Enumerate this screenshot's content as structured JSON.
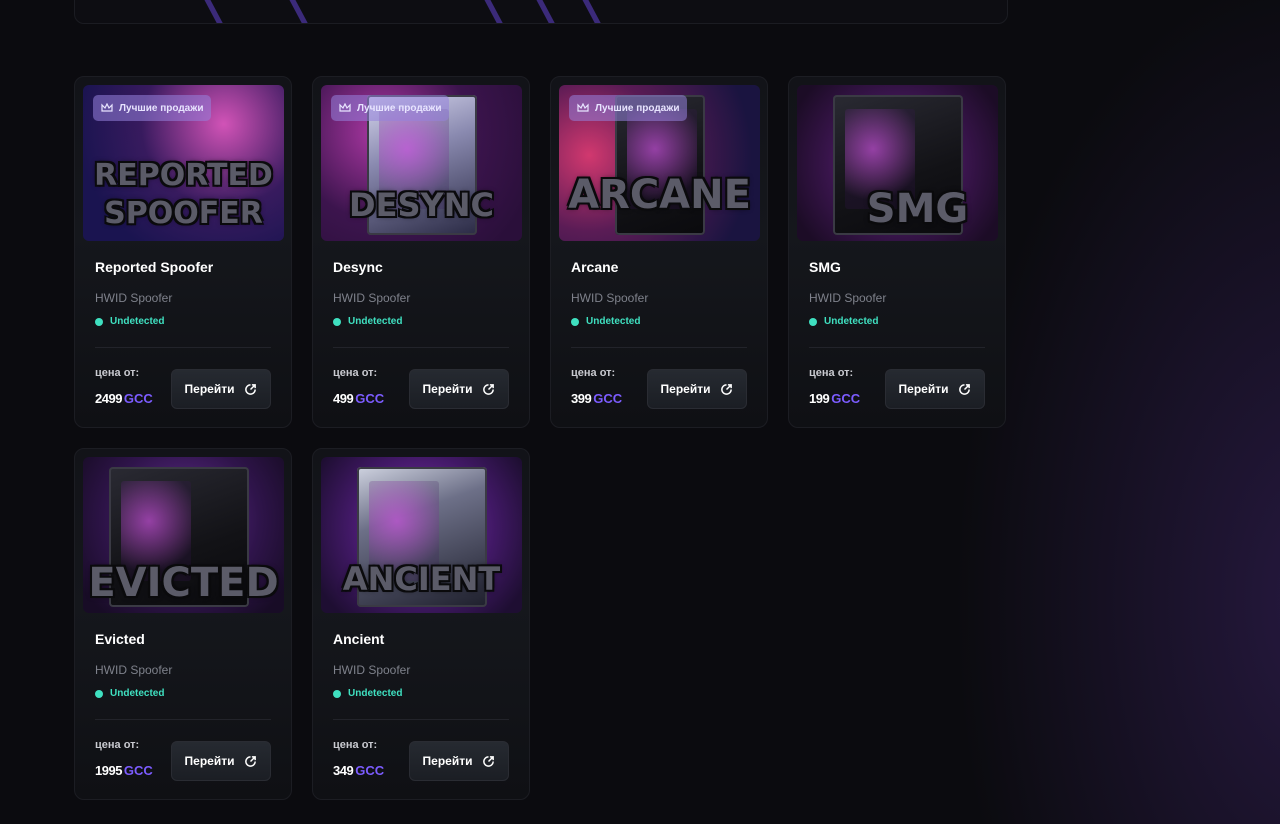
{
  "colors": {
    "accent": "#7c5cff",
    "status": "#3fe0c0",
    "badge_bg": "#9682dc"
  },
  "products": [
    {
      "title": "Reported Spoofer",
      "category": "HWID Spoofer",
      "status": "Undetected",
      "badge": "Лучшие продажи",
      "image_text": "REPORTED SPOOFER",
      "price_label": "цена от:",
      "price": "2499",
      "currency": "GCC",
      "button_label": "Перейти",
      "icon": "external-link-icon"
    },
    {
      "title": "Desync",
      "category": "HWID Spoofer",
      "status": "Undetected",
      "badge": "Лучшие продажи",
      "image_text": "DESYNC",
      "price_label": "цена от:",
      "price": "499",
      "currency": "GCC",
      "button_label": "Перейти",
      "icon": "external-link-icon"
    },
    {
      "title": "Arcane",
      "category": "HWID Spoofer",
      "status": "Undetected",
      "badge": "Лучшие продажи",
      "image_text": "ARCANE",
      "price_label": "цена от:",
      "price": "399",
      "currency": "GCC",
      "button_label": "Перейти",
      "icon": "external-link-icon"
    },
    {
      "title": "SMG",
      "category": "HWID Spoofer",
      "status": "Undetected",
      "image_text": "SMG",
      "price_label": "цена от:",
      "price": "199",
      "currency": "GCC",
      "button_label": "Перейти",
      "icon": "external-link-icon"
    },
    {
      "title": "Evicted",
      "category": "HWID Spoofer",
      "status": "Undetected",
      "image_text": "EVICTED",
      "price_label": "цена от:",
      "price": "1995",
      "currency": "GCC",
      "button_label": "Перейти",
      "icon": "external-link-icon"
    },
    {
      "title": "Ancient",
      "category": "HWID Spoofer",
      "status": "Undetected",
      "image_text": "ANCIENT",
      "price_label": "цена от:",
      "price": "349",
      "currency": "GCC",
      "button_label": "Перейти",
      "icon": "external-link-icon"
    }
  ]
}
